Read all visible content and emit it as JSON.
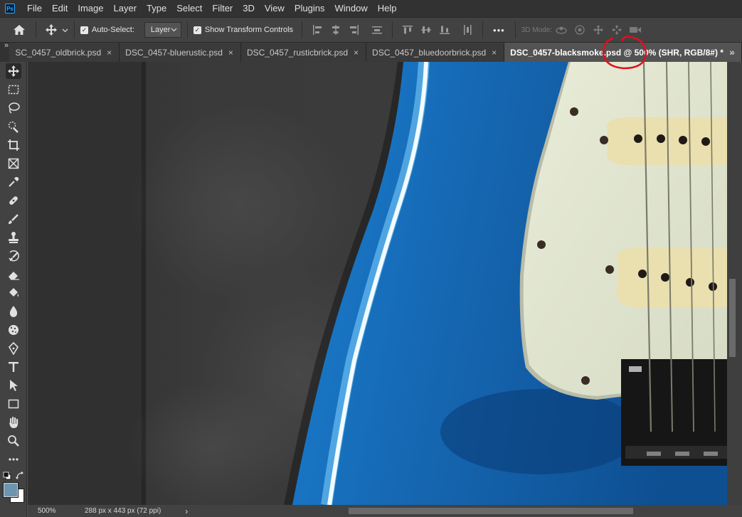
{
  "app": {
    "logo": "Ps"
  },
  "menu": [
    "File",
    "Edit",
    "Image",
    "Layer",
    "Type",
    "Select",
    "Filter",
    "3D",
    "View",
    "Plugins",
    "Window",
    "Help"
  ],
  "options": {
    "auto_select_label": "Auto-Select:",
    "auto_select_checked": true,
    "layer_dropdown": "Layer",
    "show_transform_label": "Show Transform Controls",
    "show_transform_checked": true,
    "more_label": "•••",
    "mode_3d_label": "3D Mode:"
  },
  "tabs": [
    {
      "label": "SC_0457_oldbrick.psd",
      "close": "×",
      "active": false
    },
    {
      "label": "DSC_0457-bluerustic.psd",
      "close": "×",
      "active": false
    },
    {
      "label": "DSC_0457_rusticbrick.psd",
      "close": "×",
      "active": false
    },
    {
      "label": "DSC_0457_bluedoorbrick.psd",
      "close": "×",
      "active": false
    },
    {
      "label": "DSC_0457-blacksmoke.psd @ 500% (SHR, RGB/8#) *",
      "close": "×",
      "active": true
    }
  ],
  "tabs_overflow": "»",
  "panel_collapse": "»",
  "status": {
    "zoom": "500%",
    "doc_info": "288 px x 443 px (72 ppi)",
    "arrow": "›"
  },
  "colors": {
    "foreground": "#6e95b0",
    "background": "#ffffff",
    "annotation": "#e0101a"
  },
  "tools": [
    "move-tool",
    "marquee-tool",
    "lasso-tool",
    "quick-select-tool",
    "crop-tool",
    "frame-tool",
    "eyedropper-tool",
    "healing-brush-tool",
    "brush-tool",
    "clone-stamp-tool",
    "history-brush-tool",
    "eraser-tool",
    "paint-bucket-tool",
    "blur-tool",
    "sponge-tool",
    "pen-tool",
    "type-tool",
    "path-selection-tool",
    "rectangle-tool",
    "hand-tool",
    "zoom-tool",
    "edit-toolbar"
  ]
}
